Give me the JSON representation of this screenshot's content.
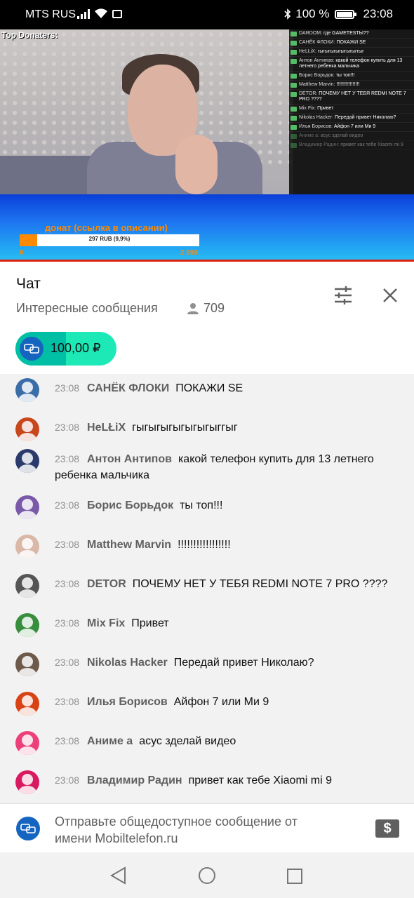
{
  "status_bar": {
    "carrier": "MTS RUS",
    "battery": "100 %",
    "time": "23:08"
  },
  "stream": {
    "top_donaters_label": "Top Donaters:",
    "donation_title": "донат (ссылка в описании)",
    "donation_progress_text": "297 RUB (9,9%)",
    "donation_progress_fraction": 0.099,
    "donation_min": "0",
    "donation_max": "2 999",
    "overlay_chat": [
      {
        "name": "DARDOM:",
        "text": "где GAMETESTЫ??"
      },
      {
        "name": "САНЁК ФЛОКИ:",
        "text": "ПОКАЖИ SE"
      },
      {
        "name": "HeLŁiX:",
        "text": "гыгыгыгыгыгыгыггыг"
      },
      {
        "name": "Антон Антипов:",
        "text": "какой телефон купить для 13 летнего ребенка мальчика"
      },
      {
        "name": "Борис Борьдок:",
        "text": "ты топ!!!"
      },
      {
        "name": "Matthew Marvin:",
        "text": "!!!!!!!!!!!!!!!!!"
      },
      {
        "name": "DETOR:",
        "text": "ПОЧЕМУ НЕТ У ТЕБЯ REDMI NOTE 7 PRO ????"
      },
      {
        "name": "Mix Fix:",
        "text": "Привет"
      },
      {
        "name": "Nikolas Hacker:",
        "text": "Передай привет Николаю?"
      },
      {
        "name": "Илья Борисов:",
        "text": "Айфон 7 или Ми 9"
      },
      {
        "name": "Аниме а:",
        "text": "асус зделай видео"
      },
      {
        "name": "Владимир Радин:",
        "text": "привет как тебе Xiaomi mi 9"
      }
    ]
  },
  "chat_header": {
    "title": "Чат",
    "mode": "Интересные сообщения",
    "viewer_count": "709",
    "super_chat_amount": "100,00 ₽"
  },
  "messages": [
    {
      "time": "23:08",
      "author": "САНЁК ФЛОКИ",
      "text": "ПОКАЖИ SE",
      "avatar_color": "#3b6ea8"
    },
    {
      "time": "23:08",
      "author": "HeLŁiX",
      "text": "гыгыгыгыгыгыгыггыг",
      "avatar_color": "#c8481e"
    },
    {
      "time": "23:08",
      "author": "Антон Антипов",
      "text": "какой телефон купить для 13 летнего ребенка мальчика",
      "avatar_color": "#2a3a6a"
    },
    {
      "time": "23:08",
      "author": "Борис Борьдок",
      "text": "ты топ!!!",
      "avatar_color": "#7a5aa8"
    },
    {
      "time": "23:08",
      "author": "Matthew Marvin",
      "text": "!!!!!!!!!!!!!!!!!",
      "avatar_color": "#d9b8a8"
    },
    {
      "time": "23:08",
      "author": "DETOR",
      "text": "ПОЧЕМУ НЕТ У ТЕБЯ REDMI NOTE 7 PRO ????",
      "avatar_color": "#555555"
    },
    {
      "time": "23:08",
      "author": "Mix Fix",
      "text": "Привет",
      "avatar_color": "#388e3c"
    },
    {
      "time": "23:08",
      "author": "Nikolas Hacker",
      "text": "Передай привет Николаю?",
      "avatar_color": "#6d5a4a"
    },
    {
      "time": "23:08",
      "author": "Илья Борисов",
      "text": "Айфон 7 или Ми 9",
      "avatar_color": "#d84315"
    },
    {
      "time": "23:08",
      "author": "Аниме а",
      "text": "асус зделай видео",
      "avatar_color": "#ec407a"
    },
    {
      "time": "23:08",
      "author": "Владимир Радин",
      "text": "привет как тебе Xiaomi mi 9",
      "avatar_color": "#d81b60"
    }
  ],
  "input": {
    "placeholder": "Отправьте общедоступное сообщение от имени Mobiltelefon.ru",
    "dollar_icon": "dollar-icon"
  }
}
